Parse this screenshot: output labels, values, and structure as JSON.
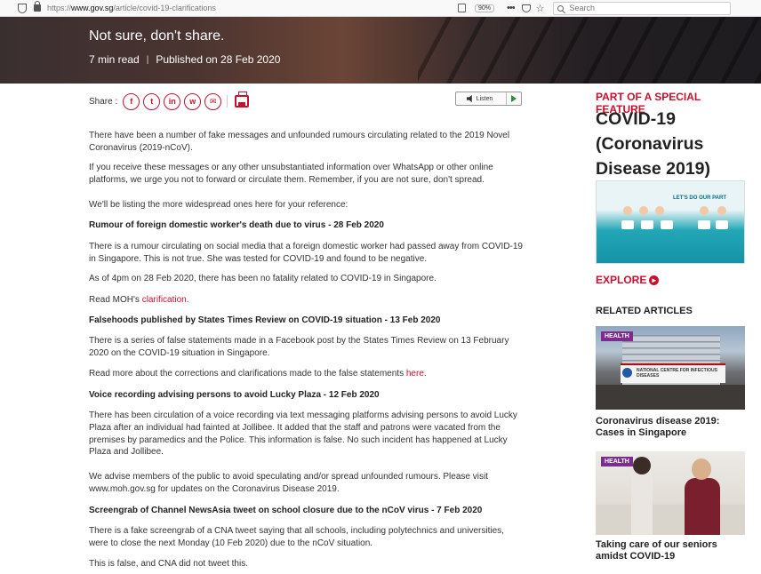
{
  "browser": {
    "url_prefix": "https://",
    "url_domain": "www.gov.sg",
    "url_path": "/article/covid-19-clarifications",
    "zoom": "90%",
    "search_placeholder": "Search"
  },
  "hero": {
    "title": "Not sure, don't share.",
    "read_time": "7 min read",
    "separator": "|",
    "published": "Published on 28 Feb 2020"
  },
  "share": {
    "label": "Share :",
    "icons": [
      {
        "name": "facebook-icon",
        "glyph": "f"
      },
      {
        "name": "twitter-icon",
        "glyph": "t"
      },
      {
        "name": "linkedin-icon",
        "glyph": "in"
      },
      {
        "name": "whatsapp-icon",
        "glyph": "w"
      },
      {
        "name": "email-icon",
        "glyph": "✉"
      }
    ],
    "accent": "#c8102e"
  },
  "listen": {
    "label": "Listen"
  },
  "article": {
    "paragraphs": [
      {
        "type": "p",
        "text": "There have been a number of fake messages and unfounded rumours circulating related to the 2019 Novel Coronavirus (2019-nCoV)."
      },
      {
        "type": "p",
        "text": "If you receive these messages or any other unsubstantiated information over WhatsApp or other online platforms, we urge you not to forward or circulate them. Remember, if you are not sure, don't spread."
      },
      {
        "type": "p",
        "text": "We'll be listing the more widespread ones here for your reference:"
      },
      {
        "type": "hd",
        "text": "Rumour of foreign domestic worker's death due to virus - 28 Feb 2020"
      },
      {
        "type": "p",
        "text": "There is a rumour circulating on social media that a foreign domestic worker had passed away from COVID-19 in Singapore. This is not true. She was tested for COVID-19 and found to be negative."
      },
      {
        "type": "p",
        "text": "As of 4pm on 28 Feb 2020, there has been no fatality related to COVID-19 in Singapore."
      },
      {
        "type": "link",
        "text": "Read MOH's ",
        "link": "clarification",
        "after": "."
      },
      {
        "type": "hd",
        "text": "Falsehoods published by States Times Review on COVID-19 situation - 13 Feb 2020"
      },
      {
        "type": "p",
        "text": "There is a series of false statements made in a Facebook post by the States Times Review on 13 February 2020 on the COVID-19 situation in Singapore."
      },
      {
        "type": "link",
        "text": "Read more about the corrections and clarifications made to the false statements ",
        "link": "here",
        "after": "."
      },
      {
        "type": "hd",
        "text": "Voice recording advising persons to avoid Lucky Plaza - 12 Feb 2020"
      },
      {
        "type": "p",
        "text": "There has been circulation of a voice recording via text messaging platforms advising persons to avoid Lucky Plaza after an individual had fainted at Jollibee. It added that the staff and patrons were vacated from the premises by paramedics and the Police. This information is false. No such incident has happened at Lucky Plaza and Jollibee."
      },
      {
        "type": "p",
        "text": "We advise members of the public to avoid speculating and/or spread unfounded rumours. Please visit www.moh.gov.sg for updates on the Coronavirus Disease 2019."
      },
      {
        "type": "hd",
        "text": "Screengrab of Channel NewsAsia tweet on school closure due to the nCoV virus - 7 Feb 2020"
      },
      {
        "type": "p",
        "text": "There is a fake screengrab of a CNA tweet saying that all schools, including polytechnics and universities, were to close the next Monday (10 Feb 2020) due to the nCoV situation."
      },
      {
        "type": "p",
        "text": "This is false, and CNA did not tweet this."
      }
    ]
  },
  "sidebar": {
    "kicker": "PART OF A SPECIAL FEATURE",
    "feature_title": "COVID-19 (Coronavirus Disease 2019)",
    "banner_text": "LET'S DO OUR PART",
    "explore": "EXPLORE",
    "related_heading": "RELATED ARTICLES",
    "related": [
      {
        "tag": "HEALTH",
        "title": "Coronavirus disease 2019: Cases in Singapore",
        "sign": "NATIONAL CENTRE FOR INFECTIOUS DISEASES"
      },
      {
        "tag": "HEALTH",
        "title": "Taking care of our seniors amidst COVID-19"
      }
    ]
  }
}
